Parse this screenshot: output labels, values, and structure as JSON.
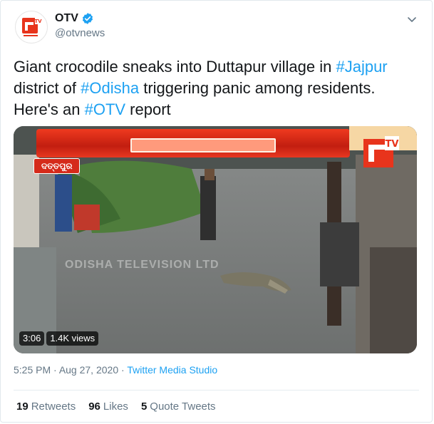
{
  "account": {
    "display_name": "OTV",
    "handle": "@otvnews",
    "verified_icon": "verified-badge-icon",
    "avatar_icon": "otv-logo-icon"
  },
  "tweet": {
    "segments": [
      {
        "text": "Giant crocodile sneaks into Duttapur village in ",
        "type": "text"
      },
      {
        "text": "#Jajpur",
        "type": "hashtag"
      },
      {
        "text": " district of ",
        "type": "text"
      },
      {
        "text": "#Odisha",
        "type": "hashtag"
      },
      {
        "text": " triggering panic among residents. Here's an ",
        "type": "text"
      },
      {
        "text": "#OTV",
        "type": "hashtag"
      },
      {
        "text": " report",
        "type": "text"
      }
    ]
  },
  "video": {
    "location_tag": "ଦତ୍ତପୁର",
    "watermark": "ODISHA TELEVISION LTD",
    "duration": "3:06",
    "views": "1.4K views",
    "channel_logo_icon": "otv-channel-logo-icon"
  },
  "meta": {
    "time": "5:25 PM",
    "sep": " · ",
    "date": "Aug 27, 2020",
    "source": "Twitter Media Studio"
  },
  "stats": {
    "retweets_count": "19",
    "retweets_label": "Retweets",
    "likes_count": "96",
    "likes_label": "Likes",
    "quotes_count": "5",
    "quotes_label": "Quote Tweets"
  },
  "colors": {
    "link": "#1da1f2",
    "secondary_text": "#657786",
    "otv_red": "#e8341c"
  }
}
